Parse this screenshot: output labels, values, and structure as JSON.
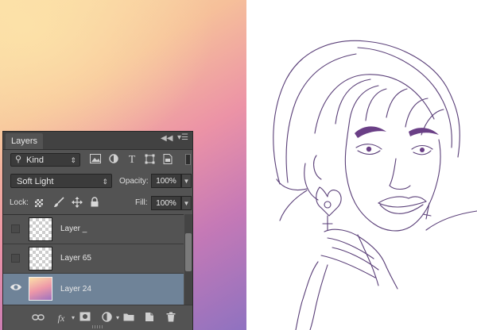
{
  "layers_panel": {
    "tab_label": "Layers",
    "filter": {
      "kind_label": "Kind"
    },
    "blend_mode": "Soft Light",
    "opacity_label": "Opacity:",
    "opacity_value": "100%",
    "lock_label": "Lock:",
    "fill_label": "Fill:",
    "fill_value": "100%",
    "layers": [
      {
        "name": "Layer _",
        "visible": false,
        "selected": false,
        "thumbnail": "transparent"
      },
      {
        "name": "Layer 65",
        "visible": false,
        "selected": false,
        "thumbnail": "transparent"
      },
      {
        "name": "Layer 24",
        "visible": true,
        "selected": true,
        "thumbnail": "gradient"
      }
    ]
  },
  "colors": {
    "panel_bg": "#535353",
    "selected_row": "#6f8398",
    "sketch_line": "#5a3f78",
    "brow_fill": "#6a3f86"
  },
  "icons": {
    "collapse": "double-chevron-left-icon",
    "panel_menu": "panel-menu-icon",
    "filters": [
      "image-filter-icon",
      "adjustment-filter-icon",
      "type-filter-icon",
      "shape-filter-icon",
      "smart-object-filter-icon"
    ],
    "locks": [
      "lock-transparent-icon",
      "lock-brush-icon",
      "lock-move-icon",
      "lock-all-icon"
    ],
    "bottom": [
      "link-icon",
      "fx-icon",
      "mask-icon",
      "adjustment-icon",
      "folder-icon",
      "new-layer-icon",
      "trash-icon"
    ]
  }
}
